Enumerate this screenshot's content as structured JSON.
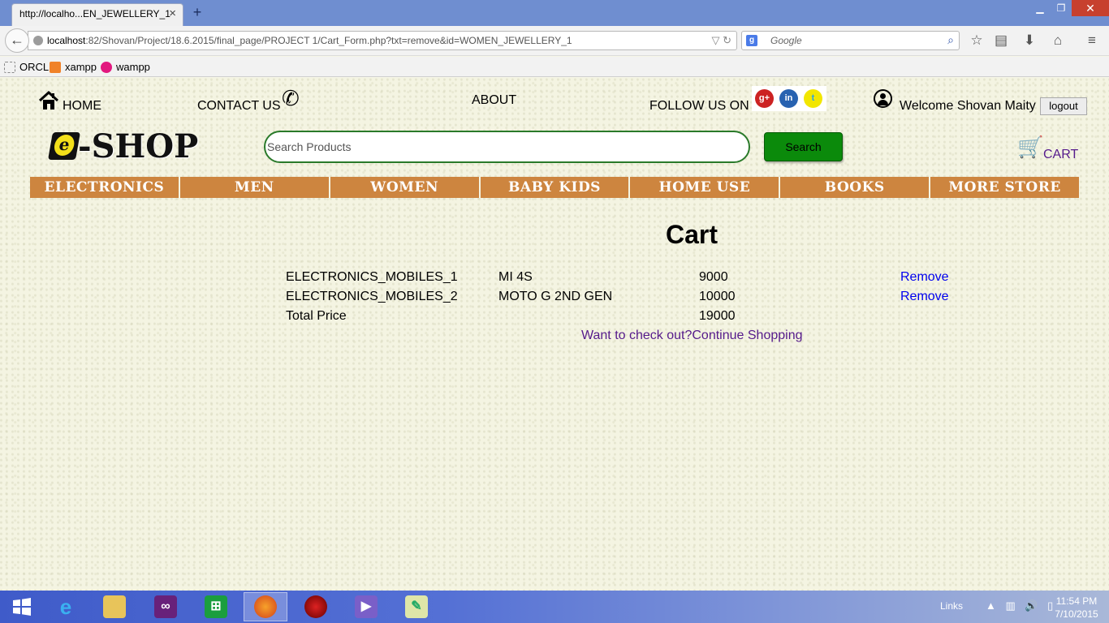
{
  "browser": {
    "tab_title": "http://localho...EN_JEWELLERY_1",
    "tab_close": "×",
    "new_tab": "+",
    "url_host": "localhost",
    "url_rest": ":82/Shovan/Project/18.6.2015/final_page/PROJECT 1/Cart_Form.php?txt=remove&id=WOMEN_JEWELLERY_1",
    "search_placeholder": "Google",
    "bookmarks": [
      {
        "label": "ORCL"
      },
      {
        "label": "xampp"
      },
      {
        "label": "wampp"
      }
    ]
  },
  "header": {
    "home": "HOME",
    "contact": "CONTACT US",
    "about": "ABOUT",
    "follow": "FOLLOW US ON",
    "social": [
      "g+",
      "in",
      "t"
    ],
    "welcome": "Welcome Shovan Maity",
    "logout": "logout"
  },
  "logo": {
    "badge": "e",
    "text": "-SHOP"
  },
  "search": {
    "placeholder": "Search Products",
    "button": "Search"
  },
  "cart_link": "CART",
  "categories": [
    "ELECTRONICS",
    "MEN",
    "WOMEN",
    "BABY KIDS",
    "HOME USE",
    "BOOKS",
    "MORE STORE"
  ],
  "cart": {
    "title": "Cart",
    "items": [
      {
        "id": "ELECTRONICS_MOBILES_1",
        "name": "MI 4S",
        "price": "9000",
        "action": "Remove"
      },
      {
        "id": "ELECTRONICS_MOBILES_2",
        "name": "MOTO G 2ND GEN",
        "price": "10000",
        "action": "Remove"
      }
    ],
    "total_label": "Total Price",
    "total_value": "19000",
    "checkout_link": "Want to check out?",
    "continue_link": "Continue Shopping"
  },
  "taskbar": {
    "links_label": "Links",
    "time": "11:54 PM",
    "date": "7/10/2015"
  },
  "colors": {
    "category_bar": "#cd853f",
    "search_button": "#0b8a0b",
    "link_blue": "#0000ee",
    "link_visited": "#551a8b"
  }
}
